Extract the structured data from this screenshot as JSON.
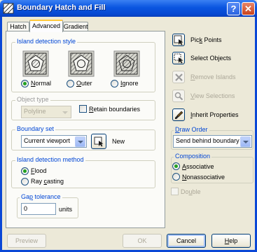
{
  "window": {
    "title": "Boundary Hatch and Fill",
    "help": "?",
    "close": "✕"
  },
  "tabs": [
    "Hatch",
    "Advanced",
    "Gradient"
  ],
  "island_style": {
    "legend": "Island detection style",
    "options": [
      {
        "pre": "",
        "key": "N",
        "post": "ormal",
        "selected": true
      },
      {
        "pre": "",
        "key": "O",
        "post": "uter",
        "selected": false
      },
      {
        "pre": "",
        "key": "I",
        "post": "gnore",
        "selected": false
      }
    ]
  },
  "object_type": {
    "legend": "Object type",
    "value": "Polyline",
    "retain": {
      "pre": "",
      "key": "R",
      "post": "etain boundaries"
    }
  },
  "boundary_set": {
    "legend": "Boundary set",
    "value": "Current viewport",
    "new": "New"
  },
  "island_method": {
    "legend": "Island detection method",
    "options": [
      {
        "pre": "",
        "key": "F",
        "post": "lood",
        "selected": true
      },
      {
        "pre": "Ray ",
        "key": "c",
        "post": "asting",
        "selected": false
      }
    ]
  },
  "gap": {
    "legend_pre": "Ga",
    "legend_key": "p",
    "legend_post": " tolerance",
    "value": "0",
    "units": "units"
  },
  "side": {
    "pick_points": {
      "pre": "Pic",
      "key": "k",
      "post": " Points"
    },
    "select_objects": {
      "pre": "Select Ob",
      "key": "j",
      "post": "ects"
    },
    "remove_islands": {
      "pre": "",
      "key": "R",
      "post": "emove Islands"
    },
    "view_selections": {
      "pre": "",
      "key": "V",
      "post": "iew Selections"
    },
    "inherit": {
      "pre": "",
      "key": "I",
      "post": "nherit Properties"
    }
  },
  "draw_order": {
    "legend_pre": "",
    "legend_key": "D",
    "legend_post": "raw Order",
    "value": "Send behind boundary"
  },
  "composition": {
    "legend": "Composition",
    "options": [
      {
        "pre": "",
        "key": "A",
        "post": "ssociative",
        "selected": true
      },
      {
        "pre": "",
        "key": "N",
        "post": "onassociative",
        "selected": false
      }
    ]
  },
  "double": {
    "pre": "Do",
    "key": "u",
    "post": "ble"
  },
  "footer": {
    "preview": "Preview",
    "ok": "OK",
    "cancel": "Cancel",
    "help_pre": "",
    "help_key": "H",
    "help_post": "elp"
  },
  "colors": {
    "accent": "#0046d5",
    "titlebar": "#0a55e0",
    "selected_radio": "#21a121"
  }
}
